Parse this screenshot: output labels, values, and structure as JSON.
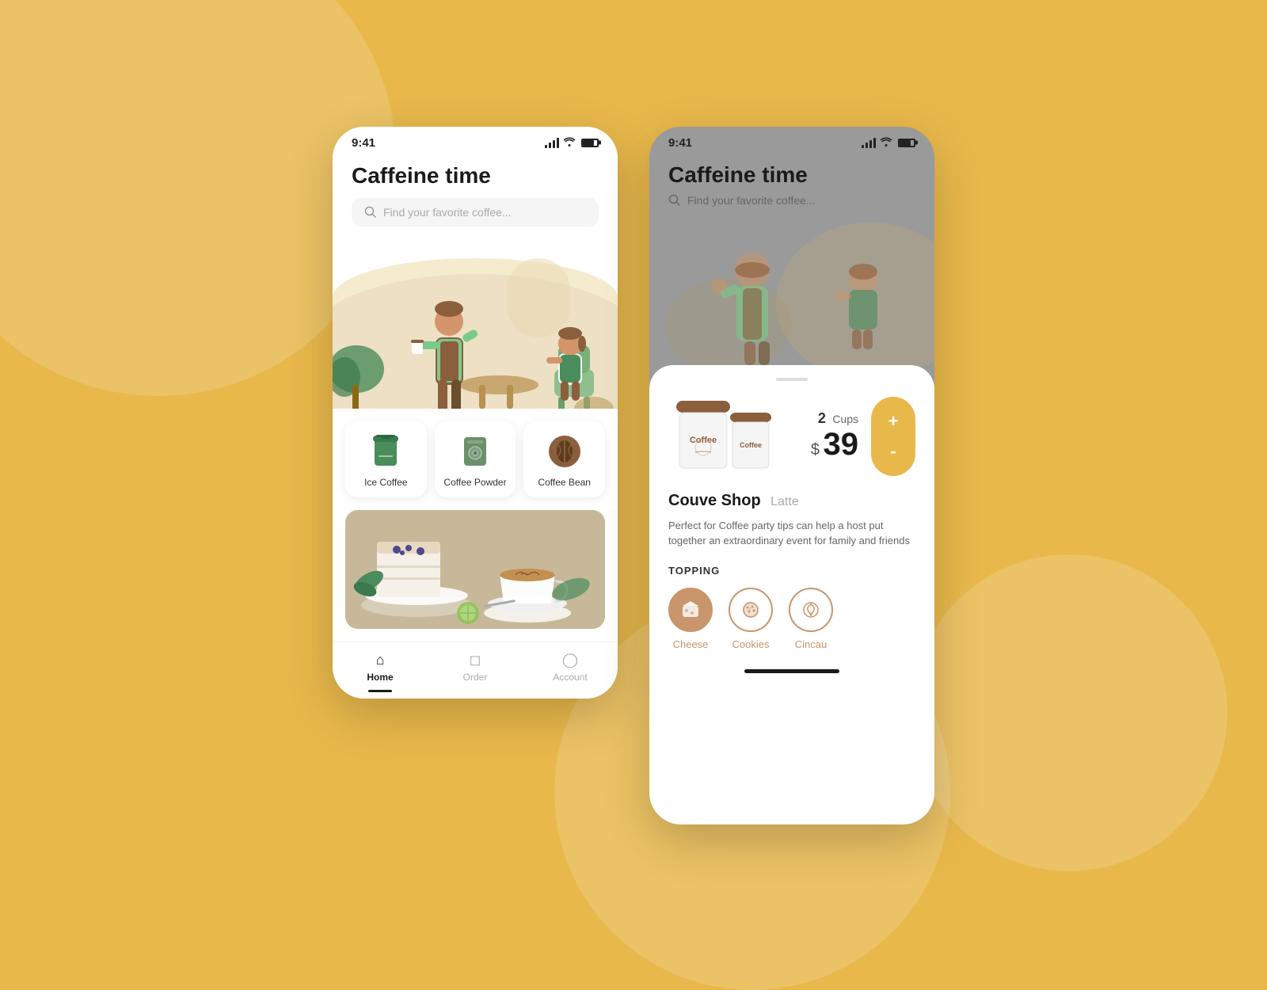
{
  "background": {
    "color": "#E8B84B"
  },
  "screen1": {
    "status_bar": {
      "time": "9:41",
      "signal": "4 bars",
      "wifi": true,
      "battery": true
    },
    "title": "Caffeine time",
    "search_placeholder": "Find your favorite coffee...",
    "categories": [
      {
        "id": "ice-coffee",
        "label": "Ice Coffee",
        "icon": "ice-cup"
      },
      {
        "id": "coffee-powder",
        "label": "Coffee Powder",
        "icon": "powder"
      },
      {
        "id": "coffee-bean",
        "label": "Coffee Bean",
        "icon": "bean"
      }
    ],
    "nav": {
      "items": [
        {
          "id": "home",
          "label": "Home",
          "active": true
        },
        {
          "id": "order",
          "label": "Order",
          "active": false
        },
        {
          "id": "account",
          "label": "Account",
          "active": false
        }
      ]
    }
  },
  "screen2": {
    "status_bar": {
      "time": "9:41"
    },
    "title": "Caffeine time",
    "search_placeholder": "Find your favorite coffee...",
    "product": {
      "shop_name": "Couve Shop",
      "type": "Latte",
      "quantity": 2,
      "quantity_label": "Cups",
      "price": 39,
      "currency": "$",
      "description": "Perfect for Coffee party tips can help a host put together an extraordinary event for family and friends"
    },
    "topping": {
      "title": "TOPPING",
      "items": [
        {
          "id": "cheese",
          "label": "Cheese",
          "active": true,
          "icon": "🧀"
        },
        {
          "id": "cookies",
          "label": "Cookies",
          "active": false,
          "icon": "🍪"
        },
        {
          "id": "cincau",
          "label": "Cincau",
          "active": false,
          "icon": "🌿"
        }
      ]
    },
    "qty_controls": {
      "plus": "+",
      "minus": "-"
    }
  }
}
